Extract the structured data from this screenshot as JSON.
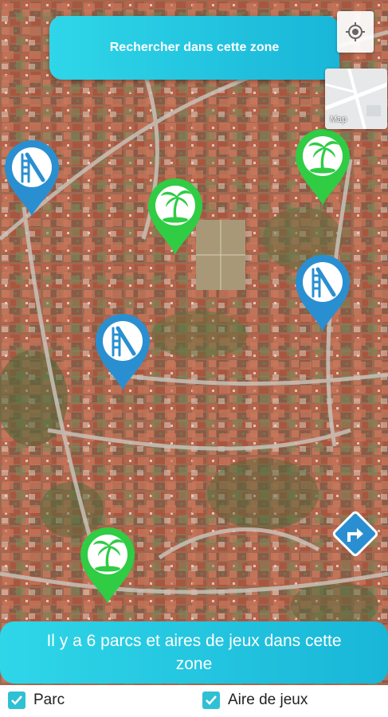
{
  "search_area_button": {
    "label": "Rechercher dans cette zone"
  },
  "map_type_button": {
    "label": "Map"
  },
  "markers": [
    {
      "type": "aire-de-jeux",
      "icon": "slide-icon",
      "color": "#2a8fd0"
    },
    {
      "type": "parc",
      "icon": "palm-tree-icon",
      "color": "#2fcc44"
    },
    {
      "type": "parc",
      "icon": "palm-tree-icon",
      "color": "#2fcc44"
    },
    {
      "type": "aire-de-jeux",
      "icon": "slide-icon",
      "color": "#2a8fd0"
    },
    {
      "type": "aire-de-jeux",
      "icon": "slide-icon",
      "color": "#2a8fd0"
    },
    {
      "type": "parc",
      "icon": "palm-tree-icon",
      "color": "#2fcc44"
    }
  ],
  "result_banner": {
    "text": "Il y a 6 parcs et aires de jeux dans cette zone"
  },
  "filters": [
    {
      "label": "Parc",
      "checked": true
    },
    {
      "label": "Aire de jeux",
      "checked": true
    }
  ],
  "colors": {
    "accent": "#19b6d8",
    "park_marker": "#2fcc44",
    "playground_marker": "#2a8fd0"
  }
}
